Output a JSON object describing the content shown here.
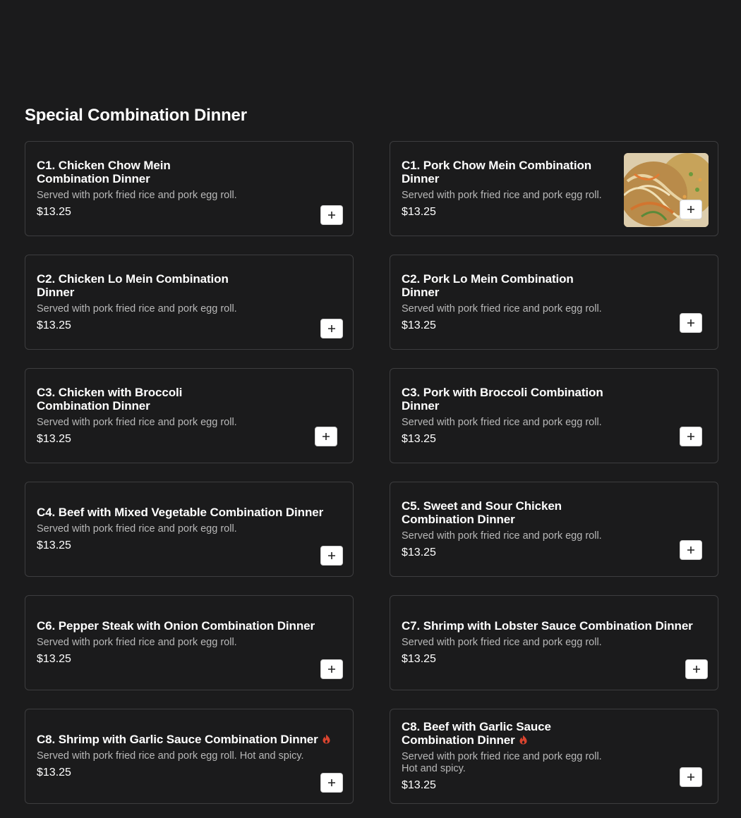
{
  "section": {
    "title": "Special Combination Dinner"
  },
  "menu": {
    "items": [
      {
        "name": "C1. Chicken Chow Mein Combination Dinner",
        "description": "Served with pork fried rice and pork egg roll.",
        "price": "$13.25",
        "spicy": false,
        "has_photo": false
      },
      {
        "name": "C1. Pork Chow Mein Combination Dinner",
        "description": "Served with pork fried rice and pork egg roll.",
        "price": "$13.25",
        "spicy": false,
        "has_photo": true
      },
      {
        "name": "C2. Chicken Lo Mein Combination Dinner",
        "description": "Served with pork fried rice and pork egg roll.",
        "price": "$13.25",
        "spicy": false,
        "has_photo": false
      },
      {
        "name": "C2. Pork Lo Mein Combination Dinner",
        "description": "Served with pork fried rice and pork egg roll.",
        "price": "$13.25",
        "spicy": false,
        "has_photo": false
      },
      {
        "name": "C3. Chicken with Broccoli Combination Dinner",
        "description": "Served with pork fried rice and pork egg roll.",
        "price": "$13.25",
        "spicy": false,
        "has_photo": false
      },
      {
        "name": "C3. Pork with Broccoli Combination Dinner",
        "description": "Served with pork fried rice and pork egg roll.",
        "price": "$13.25",
        "spicy": false,
        "has_photo": false
      },
      {
        "name": "C4. Beef with Mixed Vegetable Combination Dinner",
        "description": "Served with pork fried rice and pork egg roll.",
        "price": "$13.25",
        "spicy": false,
        "has_photo": false
      },
      {
        "name": "C5. Sweet and Sour Chicken Combination Dinner",
        "description": "Served with pork fried rice and pork egg roll.",
        "price": "$13.25",
        "spicy": false,
        "has_photo": false
      },
      {
        "name": "C6. Pepper Steak with Onion Combination Dinner",
        "description": "Served with pork fried rice and pork egg roll.",
        "price": "$13.25",
        "spicy": false,
        "has_photo": false
      },
      {
        "name": "C7. Shrimp with Lobster Sauce Combination Dinner",
        "description": "Served with pork fried rice and pork egg roll.",
        "price": "$13.25",
        "spicy": false,
        "has_photo": false
      },
      {
        "name": "C8. Shrimp with Garlic Sauce Combination Dinner",
        "description": "Served with pork fried rice and pork egg roll. Hot and spicy.",
        "price": "$13.25",
        "spicy": true,
        "has_photo": false
      },
      {
        "name": "C8. Beef with Garlic Sauce Combination Dinner",
        "description": "Served with pork fried rice and pork egg roll. Hot and spicy.",
        "price": "$13.25",
        "spicy": true,
        "has_photo": false
      }
    ]
  },
  "icons": {
    "add": "plus-icon",
    "spicy": "chili-flame-icon"
  },
  "colors": {
    "background": "#1b1b1c",
    "card_border": "#3d3d3f",
    "spicy": "#d9442f",
    "description": "#b8b8b8"
  }
}
